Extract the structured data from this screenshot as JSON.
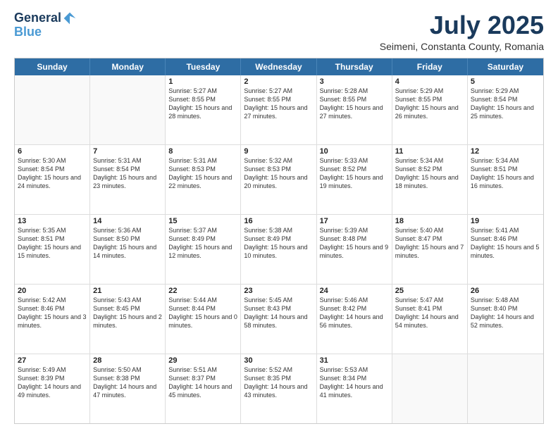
{
  "logo": {
    "line1": "General",
    "line2": "Blue"
  },
  "title": {
    "month_year": "July 2025",
    "location": "Seimeni, Constanta County, Romania"
  },
  "weekdays": [
    "Sunday",
    "Monday",
    "Tuesday",
    "Wednesday",
    "Thursday",
    "Friday",
    "Saturday"
  ],
  "rows": [
    [
      {
        "day": "",
        "empty": true
      },
      {
        "day": "",
        "empty": true
      },
      {
        "day": "1",
        "sunrise": "Sunrise: 5:27 AM",
        "sunset": "Sunset: 8:55 PM",
        "daylight": "Daylight: 15 hours and 28 minutes."
      },
      {
        "day": "2",
        "sunrise": "Sunrise: 5:27 AM",
        "sunset": "Sunset: 8:55 PM",
        "daylight": "Daylight: 15 hours and 27 minutes."
      },
      {
        "day": "3",
        "sunrise": "Sunrise: 5:28 AM",
        "sunset": "Sunset: 8:55 PM",
        "daylight": "Daylight: 15 hours and 27 minutes."
      },
      {
        "day": "4",
        "sunrise": "Sunrise: 5:29 AM",
        "sunset": "Sunset: 8:55 PM",
        "daylight": "Daylight: 15 hours and 26 minutes."
      },
      {
        "day": "5",
        "sunrise": "Sunrise: 5:29 AM",
        "sunset": "Sunset: 8:54 PM",
        "daylight": "Daylight: 15 hours and 25 minutes."
      }
    ],
    [
      {
        "day": "6",
        "sunrise": "Sunrise: 5:30 AM",
        "sunset": "Sunset: 8:54 PM",
        "daylight": "Daylight: 15 hours and 24 minutes."
      },
      {
        "day": "7",
        "sunrise": "Sunrise: 5:31 AM",
        "sunset": "Sunset: 8:54 PM",
        "daylight": "Daylight: 15 hours and 23 minutes."
      },
      {
        "day": "8",
        "sunrise": "Sunrise: 5:31 AM",
        "sunset": "Sunset: 8:53 PM",
        "daylight": "Daylight: 15 hours and 22 minutes."
      },
      {
        "day": "9",
        "sunrise": "Sunrise: 5:32 AM",
        "sunset": "Sunset: 8:53 PM",
        "daylight": "Daylight: 15 hours and 20 minutes."
      },
      {
        "day": "10",
        "sunrise": "Sunrise: 5:33 AM",
        "sunset": "Sunset: 8:52 PM",
        "daylight": "Daylight: 15 hours and 19 minutes."
      },
      {
        "day": "11",
        "sunrise": "Sunrise: 5:34 AM",
        "sunset": "Sunset: 8:52 PM",
        "daylight": "Daylight: 15 hours and 18 minutes."
      },
      {
        "day": "12",
        "sunrise": "Sunrise: 5:34 AM",
        "sunset": "Sunset: 8:51 PM",
        "daylight": "Daylight: 15 hours and 16 minutes."
      }
    ],
    [
      {
        "day": "13",
        "sunrise": "Sunrise: 5:35 AM",
        "sunset": "Sunset: 8:51 PM",
        "daylight": "Daylight: 15 hours and 15 minutes."
      },
      {
        "day": "14",
        "sunrise": "Sunrise: 5:36 AM",
        "sunset": "Sunset: 8:50 PM",
        "daylight": "Daylight: 15 hours and 14 minutes."
      },
      {
        "day": "15",
        "sunrise": "Sunrise: 5:37 AM",
        "sunset": "Sunset: 8:49 PM",
        "daylight": "Daylight: 15 hours and 12 minutes."
      },
      {
        "day": "16",
        "sunrise": "Sunrise: 5:38 AM",
        "sunset": "Sunset: 8:49 PM",
        "daylight": "Daylight: 15 hours and 10 minutes."
      },
      {
        "day": "17",
        "sunrise": "Sunrise: 5:39 AM",
        "sunset": "Sunset: 8:48 PM",
        "daylight": "Daylight: 15 hours and 9 minutes."
      },
      {
        "day": "18",
        "sunrise": "Sunrise: 5:40 AM",
        "sunset": "Sunset: 8:47 PM",
        "daylight": "Daylight: 15 hours and 7 minutes."
      },
      {
        "day": "19",
        "sunrise": "Sunrise: 5:41 AM",
        "sunset": "Sunset: 8:46 PM",
        "daylight": "Daylight: 15 hours and 5 minutes."
      }
    ],
    [
      {
        "day": "20",
        "sunrise": "Sunrise: 5:42 AM",
        "sunset": "Sunset: 8:46 PM",
        "daylight": "Daylight: 15 hours and 3 minutes."
      },
      {
        "day": "21",
        "sunrise": "Sunrise: 5:43 AM",
        "sunset": "Sunset: 8:45 PM",
        "daylight": "Daylight: 15 hours and 2 minutes."
      },
      {
        "day": "22",
        "sunrise": "Sunrise: 5:44 AM",
        "sunset": "Sunset: 8:44 PM",
        "daylight": "Daylight: 15 hours and 0 minutes."
      },
      {
        "day": "23",
        "sunrise": "Sunrise: 5:45 AM",
        "sunset": "Sunset: 8:43 PM",
        "daylight": "Daylight: 14 hours and 58 minutes."
      },
      {
        "day": "24",
        "sunrise": "Sunrise: 5:46 AM",
        "sunset": "Sunset: 8:42 PM",
        "daylight": "Daylight: 14 hours and 56 minutes."
      },
      {
        "day": "25",
        "sunrise": "Sunrise: 5:47 AM",
        "sunset": "Sunset: 8:41 PM",
        "daylight": "Daylight: 14 hours and 54 minutes."
      },
      {
        "day": "26",
        "sunrise": "Sunrise: 5:48 AM",
        "sunset": "Sunset: 8:40 PM",
        "daylight": "Daylight: 14 hours and 52 minutes."
      }
    ],
    [
      {
        "day": "27",
        "sunrise": "Sunrise: 5:49 AM",
        "sunset": "Sunset: 8:39 PM",
        "daylight": "Daylight: 14 hours and 49 minutes."
      },
      {
        "day": "28",
        "sunrise": "Sunrise: 5:50 AM",
        "sunset": "Sunset: 8:38 PM",
        "daylight": "Daylight: 14 hours and 47 minutes."
      },
      {
        "day": "29",
        "sunrise": "Sunrise: 5:51 AM",
        "sunset": "Sunset: 8:37 PM",
        "daylight": "Daylight: 14 hours and 45 minutes."
      },
      {
        "day": "30",
        "sunrise": "Sunrise: 5:52 AM",
        "sunset": "Sunset: 8:35 PM",
        "daylight": "Daylight: 14 hours and 43 minutes."
      },
      {
        "day": "31",
        "sunrise": "Sunrise: 5:53 AM",
        "sunset": "Sunset: 8:34 PM",
        "daylight": "Daylight: 14 hours and 41 minutes."
      },
      {
        "day": "",
        "empty": true
      },
      {
        "day": "",
        "empty": true
      }
    ]
  ]
}
